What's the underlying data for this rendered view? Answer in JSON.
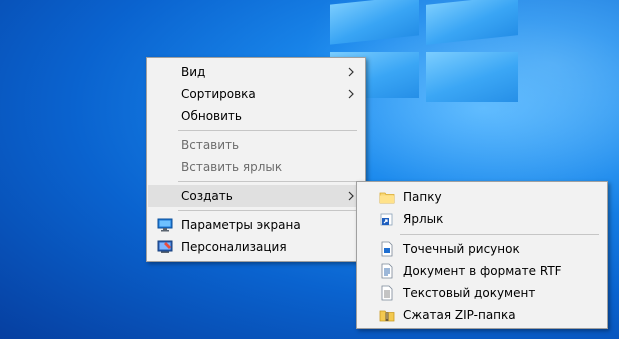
{
  "context_menu": {
    "items": [
      {
        "label": "Вид"
      },
      {
        "label": "Сортировка"
      },
      {
        "label": "Обновить"
      },
      {
        "label": "Вставить"
      },
      {
        "label": "Вставить ярлык"
      },
      {
        "label": "Создать"
      },
      {
        "label": "Параметры экрана",
        "icon": "display-settings-icon"
      },
      {
        "label": "Персонализация",
        "icon": "personalization-icon"
      }
    ]
  },
  "create_submenu": {
    "items": [
      {
        "label": "Папку",
        "icon": "folder-icon"
      },
      {
        "label": "Ярлык",
        "icon": "shortcut-icon"
      },
      {
        "label": "Точечный рисунок",
        "icon": "bitmap-image-icon"
      },
      {
        "label": "Документ в формате RTF",
        "icon": "rtf-document-icon"
      },
      {
        "label": "Текстовый документ",
        "icon": "text-document-icon"
      },
      {
        "label": "Сжатая ZIP-папка",
        "icon": "zip-folder-icon"
      }
    ]
  },
  "colors": {
    "menu_bg": "#f2f2f2",
    "highlight": "#e0e0e0",
    "disabled_text": "#6d6d6d",
    "desktop_blue": "#0a63cf"
  }
}
